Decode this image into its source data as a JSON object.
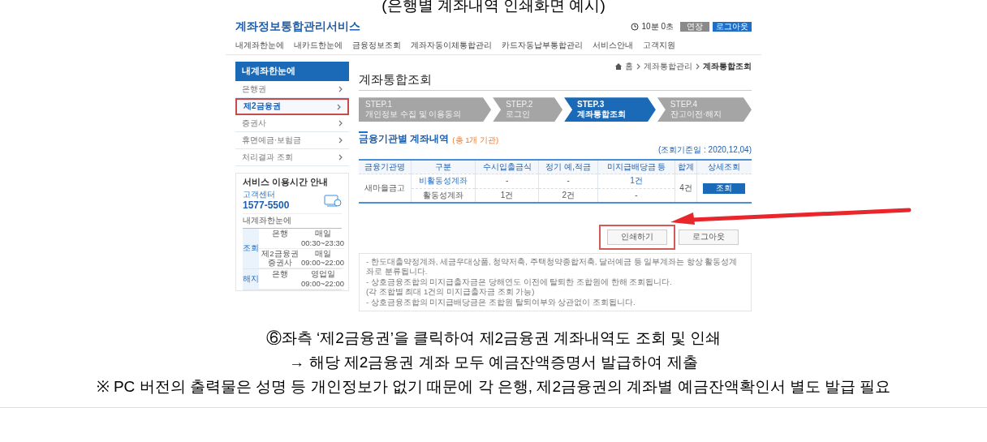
{
  "caption_top": "(은행별 계좌내역 인쇄화면 예시)",
  "site": {
    "logo": "계좌정보통합관리서비스",
    "timer": "10분 0초",
    "extend_button": "연장",
    "logout_button": "로그아웃",
    "nav": [
      "내계좌한눈에",
      "내카드한눈에",
      "금융정보조회",
      "계좌자동이체통합관리",
      "카드자동납부통합관리",
      "서비스안내",
      "고객지원"
    ],
    "breadcrumb": [
      "홈",
      "계좌통합관리",
      "계좌통합조회"
    ],
    "sidebar": {
      "title": "내계좌한눈에",
      "items": [
        {
          "label": "은행권",
          "selected": false
        },
        {
          "label": "제2금융권",
          "selected": true
        },
        {
          "label": "증권사",
          "selected": false
        },
        {
          "label": "휴면예금·보험금",
          "selected": false
        },
        {
          "label": "처리결과 조회",
          "selected": false
        }
      ],
      "service": {
        "title": "서비스 이용시간 안내",
        "center_label": "고객센터",
        "phone": "1577-5500",
        "subtitle": "내계좌한눈에",
        "groups": [
          {
            "label": "조회",
            "slots": [
              {
                "banks": [
                  "은행"
                ],
                "hours": "매일 00:30~23:30"
              },
              {
                "banks": [
                  "제2금융권",
                  "증권사"
                ],
                "hours": "매일 09:00~22:00"
              }
            ]
          },
          {
            "label": "해지",
            "slots": [
              {
                "banks": [
                  "은행"
                ],
                "hours": "영업일 09:00~22:00"
              }
            ]
          }
        ]
      }
    },
    "main": {
      "title": "계좌통합조회",
      "steps": [
        {
          "step": "STEP.1",
          "label": "개인정보 수집 및 이용동의",
          "selected": false
        },
        {
          "step": "STEP.2",
          "label": "로그인",
          "selected": false
        },
        {
          "step": "STEP.3",
          "label": "계좌통합조회",
          "selected": true
        },
        {
          "step": "STEP.4",
          "label": "잔고이전·해지",
          "selected": false
        }
      ],
      "section_title": "금융기관별 계좌내역",
      "section_note": "(총 1개 기관)",
      "date": "(조회기준일 : 2020,12,04)",
      "table": {
        "columns": [
          "금융기관명",
          "구분",
          "수시입출금식",
          "정기 예,적금",
          "미지급배당금 등",
          "합계",
          "상세조회"
        ],
        "rows": [
          {
            "cells": [
              {
                "text": "새마을금고",
                "kind": "text",
                "rowspan": 2
              },
              {
                "text": "비활동성계좌",
                "kind": "link"
              },
              {
                "text": "-",
                "kind": "text"
              },
              {
                "text": "-",
                "kind": "text"
              },
              {
                "text": "1건",
                "kind": "link"
              },
              {
                "text": "4건",
                "kind": "text",
                "rowspan": 2
              },
              {
                "text": "조회",
                "kind": "button",
                "rowspan": 2
              }
            ]
          },
          {
            "cells": [
              {
                "text": "활동성계좌",
                "kind": "text"
              },
              {
                "text": "1건",
                "kind": "text"
              },
              {
                "text": "2건",
                "kind": "text"
              },
              {
                "text": "-",
                "kind": "text"
              }
            ]
          }
        ]
      },
      "buttons": [
        {
          "label": "인쇄하기",
          "highlighted": true
        },
        {
          "label": "로그아웃",
          "highlighted": false
        }
      ],
      "notes": [
        "- 한도대출약정계좌, 세금우대상품, 청약저축, 주택청약종합저축, 달러예금 등 일부계좌는 항상 활동성계좌로 분류됩니다.",
        "- 상호금융조합의 미지급출자금은 당해연도 이전에 탈퇴한 조합원에 한해 조회됩니다.",
        "(각 조합별 최대 1건의 미지급출자금 조회 가능)",
        "- 상호금융조합의 미지급배당금은 조합원 탈퇴여부와 상관없이 조회됩니다."
      ]
    }
  },
  "captions": [
    "⑥좌측 ‘제2금융권’을 클릭하여 제2금융권 계좌내역도 조회 및 인쇄",
    "→ 해당 제2금융권 계좌 모두 예금잔액증명서 발급하여 제출",
    "※ PC 버전의 출력물은 성명 등 개인정보가 없기 때문에 각 은행, 제2금융권의 계좌별 예금잔액확인서 별도 발급 필요"
  ]
}
